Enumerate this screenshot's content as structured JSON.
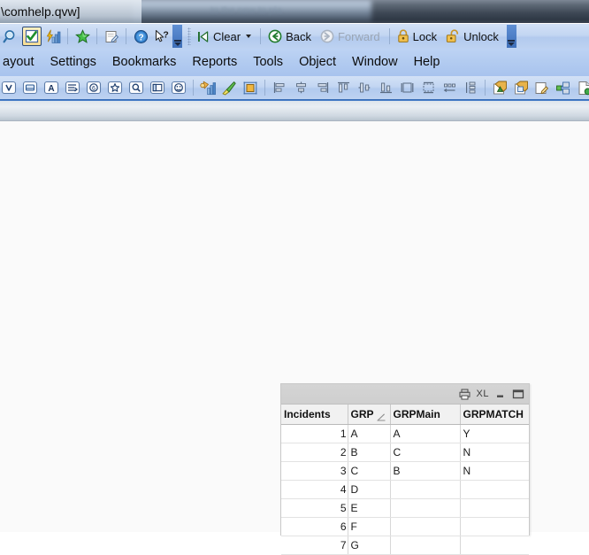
{
  "window": {
    "title": "\\comhelp.qvw]"
  },
  "toolbar_main": {
    "icon_buttons": [
      {
        "name": "search-icon",
        "label": "Search"
      },
      {
        "name": "current-selections-icon",
        "label": "Current Selections",
        "selected": true
      },
      {
        "name": "chart-lightning-icon",
        "label": "Quick Chart"
      },
      {
        "name": "star-icon",
        "label": "Bookmarks"
      },
      {
        "name": "edit-script-icon",
        "label": "Edit Script"
      },
      {
        "name": "help-icon",
        "label": "Help"
      },
      {
        "name": "whats-this-icon",
        "label": "What's This?"
      }
    ],
    "command_buttons": [
      {
        "name": "clear-button",
        "label": "Clear",
        "icon": "clear-icon",
        "has_dropdown": true,
        "disabled": false
      },
      {
        "name": "back-button",
        "label": "Back",
        "icon": "back-icon",
        "has_dropdown": false,
        "disabled": false
      },
      {
        "name": "forward-button",
        "label": "Forward",
        "icon": "forward-icon",
        "has_dropdown": false,
        "disabled": true
      },
      {
        "name": "lock-button",
        "label": "Lock",
        "icon": "lock-icon",
        "has_dropdown": false,
        "disabled": false
      },
      {
        "name": "unlock-button",
        "label": "Unlock",
        "icon": "unlock-icon",
        "has_dropdown": false,
        "disabled": false
      }
    ]
  },
  "menubar": {
    "items": [
      {
        "name": "menu-layout",
        "label": "ayout"
      },
      {
        "name": "menu-settings",
        "label": "Settings"
      },
      {
        "name": "menu-bookmarks",
        "label": "Bookmarks"
      },
      {
        "name": "menu-reports",
        "label": "Reports"
      },
      {
        "name": "menu-tools",
        "label": "Tools"
      },
      {
        "name": "menu-object",
        "label": "Object"
      },
      {
        "name": "menu-window",
        "label": "Window"
      },
      {
        "name": "menu-help",
        "label": "Help"
      }
    ]
  },
  "toolbar_design": {
    "group_objects": [
      "list-box-icon",
      "statistics-box-icon",
      "text-object-icon",
      "multi-box-icon",
      "table-box-icon",
      "bookmark-object-icon",
      "search-object-icon",
      "container-object-icon",
      "button-object-icon"
    ],
    "group_tools": [
      "chart-wizard-icon",
      "paint-brush-icon",
      "grid-snap-icon"
    ],
    "group_align": [
      "align-left-icon",
      "align-center-horizontal-icon",
      "align-right-icon",
      "align-top-icon",
      "align-middle-icon",
      "align-bottom-icon",
      "same-height-icon",
      "same-width-icon",
      "space-horizontally-icon",
      "space-vertically-icon"
    ],
    "group_sheet": [
      "promote-sheet-icon",
      "demote-sheet-icon",
      "edit-sheet-icon",
      "sheet-properties-icon",
      "new-sheet-icon"
    ]
  },
  "table_object": {
    "caption": {
      "print_icon": "print-icon",
      "export_label": "XL",
      "minimize_icon": "minimize-icon",
      "maximize_icon": "maximize-icon"
    },
    "columns": [
      {
        "name": "col-incidents",
        "label": "Incidents",
        "align": "right",
        "sorted": false
      },
      {
        "name": "col-grp",
        "label": "GRP",
        "align": "left",
        "sorted": true
      },
      {
        "name": "col-grpmain",
        "label": "GRPMain",
        "align": "left",
        "sorted": false
      },
      {
        "name": "col-grpmatch",
        "label": "GRPMATCH",
        "align": "left",
        "sorted": false
      }
    ],
    "rows": [
      {
        "incidents": "1",
        "grp": "A",
        "grpmain": "A",
        "grpmatch": "Y"
      },
      {
        "incidents": "2",
        "grp": "B",
        "grpmain": "C",
        "grpmatch": "N"
      },
      {
        "incidents": "3",
        "grp": "C",
        "grpmain": "B",
        "grpmatch": "N"
      },
      {
        "incidents": "4",
        "grp": "D",
        "grpmain": "",
        "grpmatch": ""
      },
      {
        "incidents": "5",
        "grp": "E",
        "grpmain": "",
        "grpmatch": ""
      },
      {
        "incidents": "6",
        "grp": "F",
        "grpmain": "",
        "grpmatch": ""
      },
      {
        "incidents": "7",
        "grp": "G",
        "grpmain": "",
        "grpmatch": ""
      }
    ]
  },
  "colors": {
    "toolbar_blue": "#bdd2f1",
    "menubar_blue": "#b2cbf0",
    "titlebar_dark": "#3f4956",
    "canvas": "#fafafa",
    "table_caption": "#d4d4d4",
    "table_header": "#f1f1f1",
    "accent_select": "#f6dd93"
  }
}
